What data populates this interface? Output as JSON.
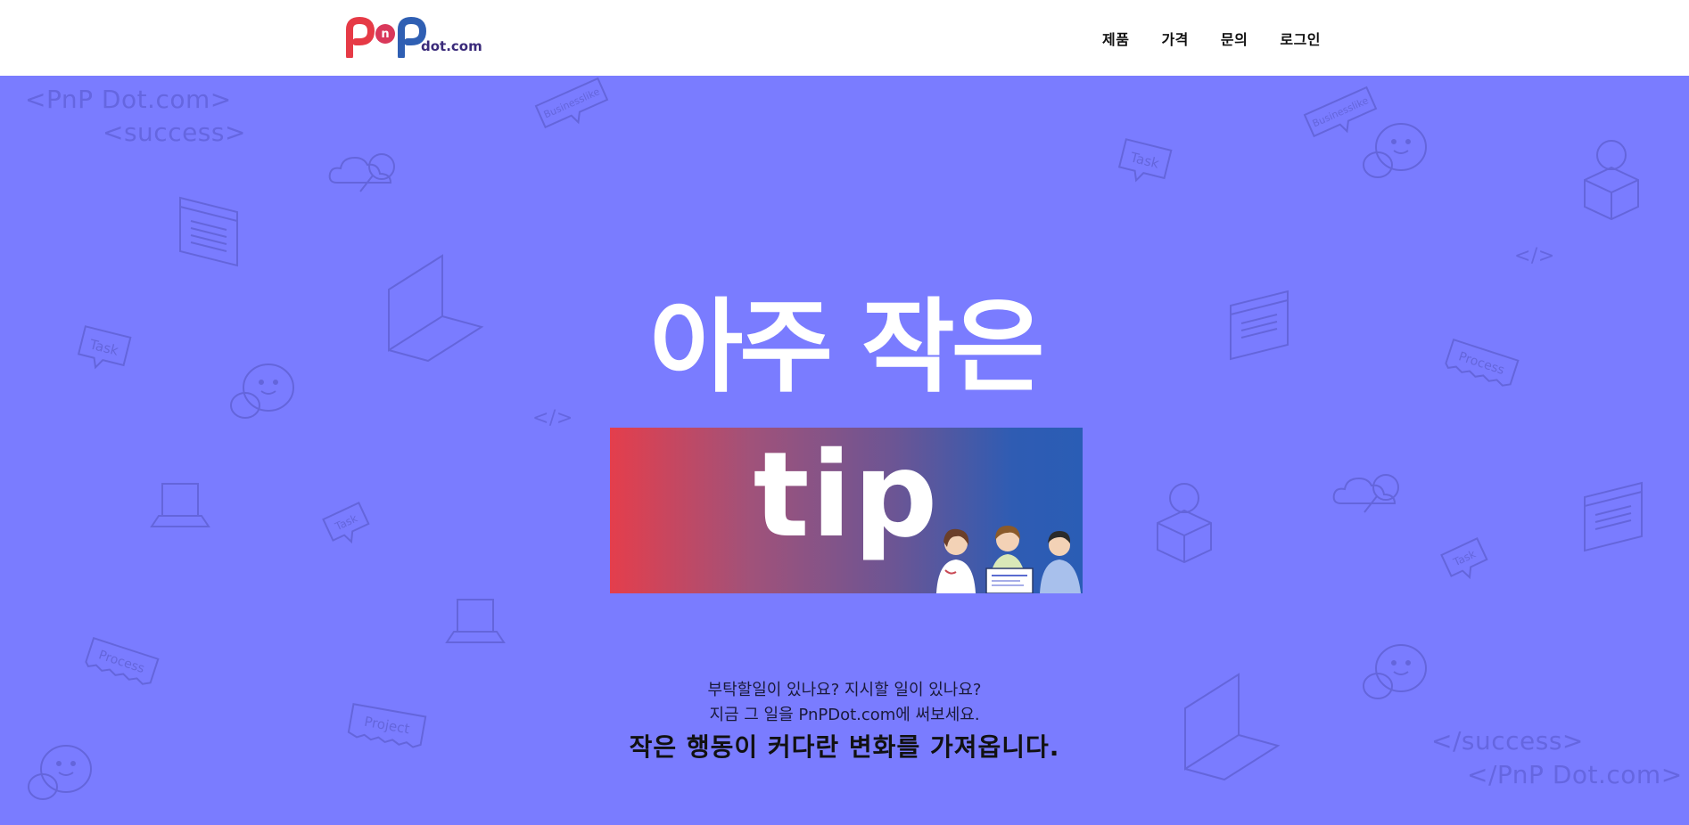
{
  "header": {
    "logo": {
      "text_main": "PnP",
      "text_suffix": "dot.com",
      "colors": {
        "p1": "#e63a46",
        "n": "#d9385a",
        "p2": "#2f5fb3",
        "suffix": "#3a2a7a"
      }
    },
    "nav": [
      {
        "label": "제품"
      },
      {
        "label": "가격"
      },
      {
        "label": "문의"
      },
      {
        "label": "로그인"
      }
    ]
  },
  "hero": {
    "background_color": "#7a7cff",
    "headline": "아주 작은",
    "tip_word": "tip",
    "tip_gradient": [
      "#e43e4c",
      "#2a5db5"
    ],
    "line1": "부탁할일이 있나요? 지시할 일이 있나요?",
    "line2": "지금 그 일을 PnPDot.com에 써보세요.",
    "line3": "작은 행동이 커다란 변화를 가져옵니다."
  },
  "background_decor": {
    "tag_open_site": "<PnP Dot.com>",
    "tag_open_success": "<success>",
    "tag_close_success": "</success>",
    "tag_close_site": "</PnP Dot.com>",
    "code_glyph": "</>",
    "labels": {
      "task": "Task",
      "process": "Process",
      "businesslike": "Businesslike",
      "project": "Project"
    },
    "icons": [
      "cloud-search-icon",
      "browser-window-icon",
      "laptop-icon",
      "chat-bubbles-icon",
      "lightbulb-box-icon",
      "code-icon"
    ]
  }
}
